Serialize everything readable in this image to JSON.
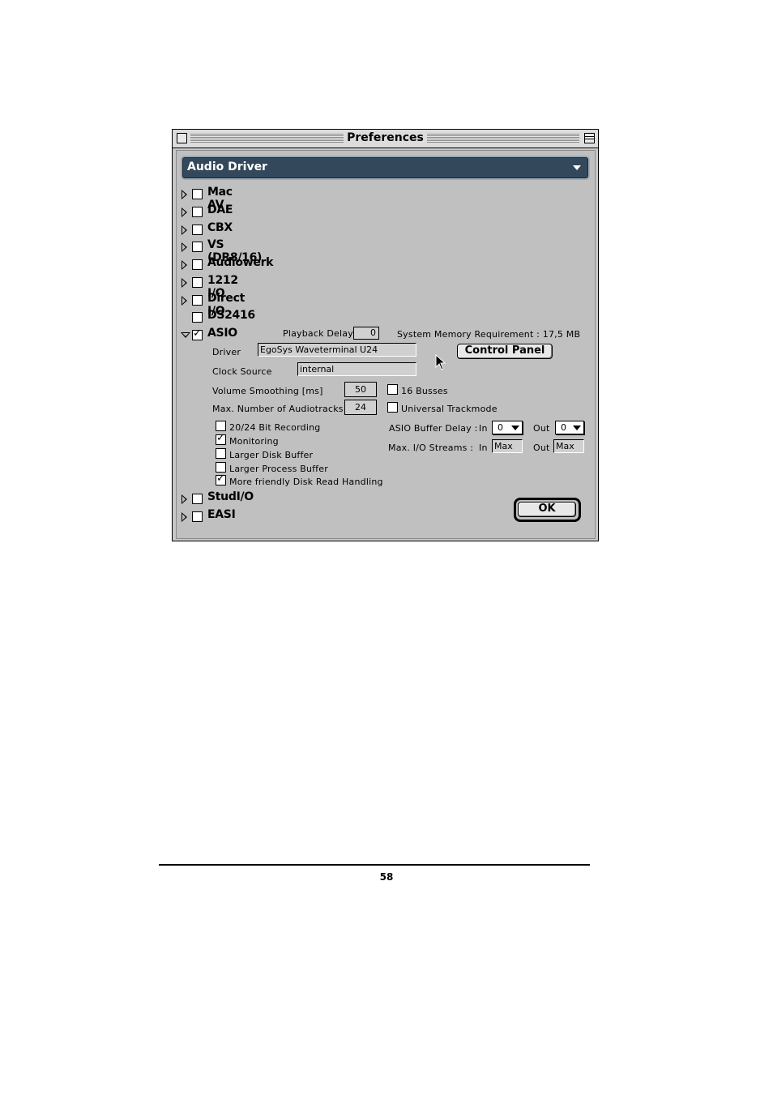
{
  "window": {
    "title": "Preferences"
  },
  "popup": {
    "selected": "Audio Driver"
  },
  "drivers": [
    {
      "label": "Mac AV",
      "checked": false
    },
    {
      "label": "DAE",
      "checked": false
    },
    {
      "label": "CBX",
      "checked": false
    },
    {
      "label": "VS (DR8/16)",
      "checked": false
    },
    {
      "label": "Audiowerk",
      "checked": false
    },
    {
      "label": "1212 I/O",
      "checked": false
    },
    {
      "label": "Direct I/O",
      "checked": false
    },
    {
      "label": "DS2416",
      "checked": false
    },
    {
      "label": "ASIO",
      "checked": true
    },
    {
      "label": "StudI/O",
      "checked": false
    },
    {
      "label": "EASI",
      "checked": false
    }
  ],
  "asio": {
    "playback_delay_label": "Playback Delay",
    "playback_delay_value": "0",
    "memory_requirement": "System Memory Requirement : 17,5 MB",
    "driver_label": "Driver",
    "driver_value": "EgoSys Waveterminal U24",
    "control_panel_button": "Control Panel",
    "clock_source_label": "Clock Source",
    "clock_source_value": "internal",
    "volume_smoothing_label": "Volume Smoothing [ms]",
    "volume_smoothing_value": "50",
    "max_audiotracks_label": "Max. Number of Audiotracks",
    "max_audiotracks_value": "24",
    "busses_label": "16 Busses",
    "trackmode_label": "Universal Trackmode",
    "options": [
      {
        "label": "20/24 Bit Recording",
        "checked": false
      },
      {
        "label": "Monitoring",
        "checked": true
      },
      {
        "label": "Larger Disk Buffer",
        "checked": false
      },
      {
        "label": "Larger Process Buffer",
        "checked": false
      },
      {
        "label": "More friendly Disk Read Handling",
        "checked": true
      }
    ],
    "buffer_delay_label": "ASIO Buffer Delay :",
    "in_label": "In",
    "out_label": "Out",
    "buffer_in_value": "0",
    "buffer_out_value": "0",
    "streams_label": "Max. I/O Streams :",
    "streams_in_value": "Max",
    "streams_out_value": "Max"
  },
  "ok_button": "OK",
  "page_number": "58"
}
